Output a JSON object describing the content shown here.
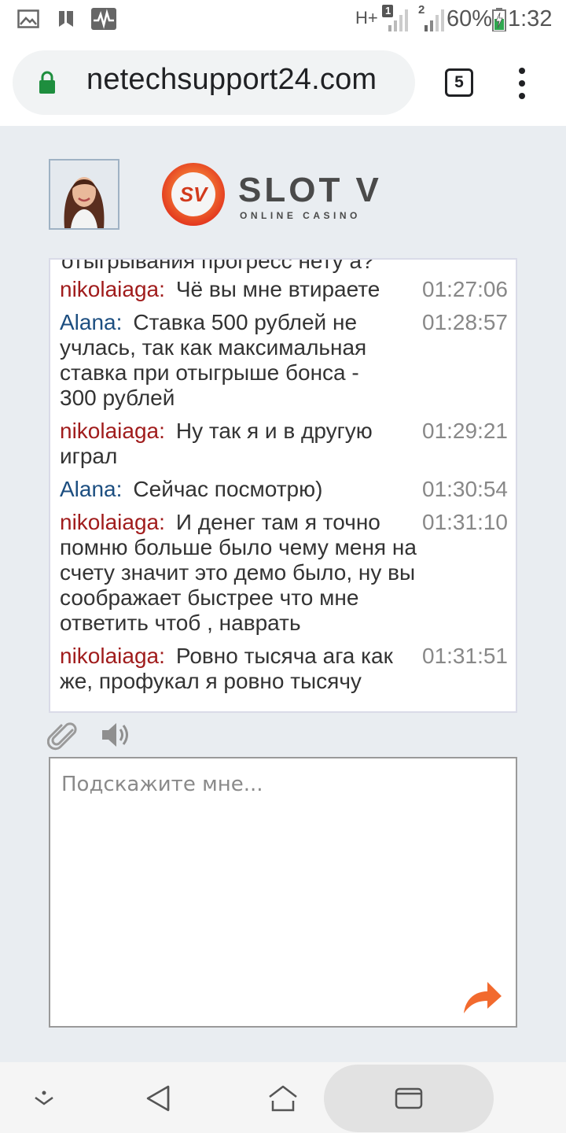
{
  "status_bar": {
    "network_type": "H+",
    "sim1": "1",
    "sim2": "2",
    "battery": "60%",
    "time": "1:32"
  },
  "browser": {
    "url": "netechsupport24.com",
    "tab_count": "5"
  },
  "chat": {
    "logo_text": "SLOT V",
    "logo_sub": "ONLINE CASINO",
    "logo_badge": "SV",
    "cut_line": "отыгрывания прогресс нету а?",
    "messages": [
      {
        "sender": "nikolaiaga:",
        "role": "user",
        "time": "01:27:06",
        "first": "Чё вы мне втираете",
        "rest": ""
      },
      {
        "sender": "Alana:",
        "role": "agent",
        "time": "01:28:57",
        "first": "Ставка 500 рублей не",
        "rest": "учлась, так как максимальная ставка при отыгрыше бонса - 300 рублей"
      },
      {
        "sender": "nikolaiaga:",
        "role": "user",
        "time": "01:29:21",
        "first": "Ну так я и в другую",
        "rest": "играл"
      },
      {
        "sender": "Alana:",
        "role": "agent",
        "time": "01:30:54",
        "first": "Сейчас посмотрю)",
        "rest": ""
      },
      {
        "sender": "nikolaiaga:",
        "role": "user",
        "time": "01:31:10",
        "first": "И денег там я точно",
        "rest": "помню больше было чему меня на счету значит это демо было, ну вы соображает быстрее что мне ответить чтоб , наврать"
      },
      {
        "sender": "nikolaiaga:",
        "role": "user",
        "time": "01:31:51",
        "first": "Ровно тысяча ага как",
        "rest": "же, профукал я ровно тысячу"
      }
    ],
    "input_placeholder": "Подскажите мне..."
  },
  "colors": {
    "user_name": "#a01c1c",
    "agent_name": "#1c4e80",
    "send_arrow": "#f26a2e",
    "lock_green": "#1e8e3e"
  },
  "icons": [
    "image-icon",
    "bookmark-icon",
    "activity-icon",
    "lock-icon",
    "paperclip-icon",
    "speaker-icon",
    "send-arrow-icon",
    "keyboard-hide-icon",
    "back-icon",
    "home-icon",
    "recents-icon"
  ]
}
